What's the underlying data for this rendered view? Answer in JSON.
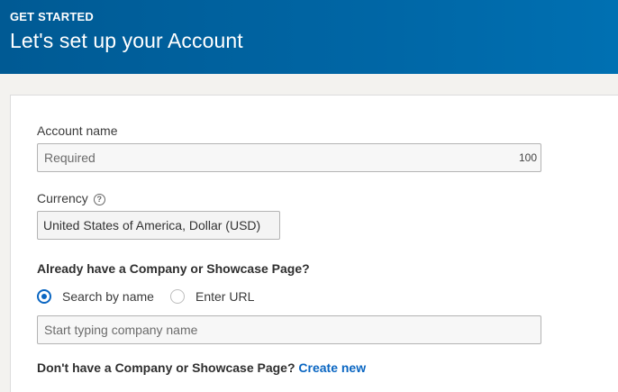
{
  "header": {
    "eyebrow": "GET STARTED",
    "title": "Let's set up your Account"
  },
  "form": {
    "account_name": {
      "label": "Account name",
      "placeholder": "Required",
      "value": "",
      "char_count": "100"
    },
    "currency": {
      "label": "Currency",
      "help_icon": "?",
      "selected": "United States of America, Dollar (USD)"
    },
    "company": {
      "question": "Already have a Company or Showcase Page?",
      "options": [
        {
          "label": "Search by name",
          "checked": true
        },
        {
          "label": "Enter URL",
          "checked": false
        }
      ],
      "search_placeholder": "Start typing company name"
    },
    "no_company": {
      "text": "Don't have a Company or Showcase Page?",
      "link": "Create new"
    }
  },
  "colors": {
    "header_bg": "#005a94",
    "accent": "#0a66c2"
  }
}
